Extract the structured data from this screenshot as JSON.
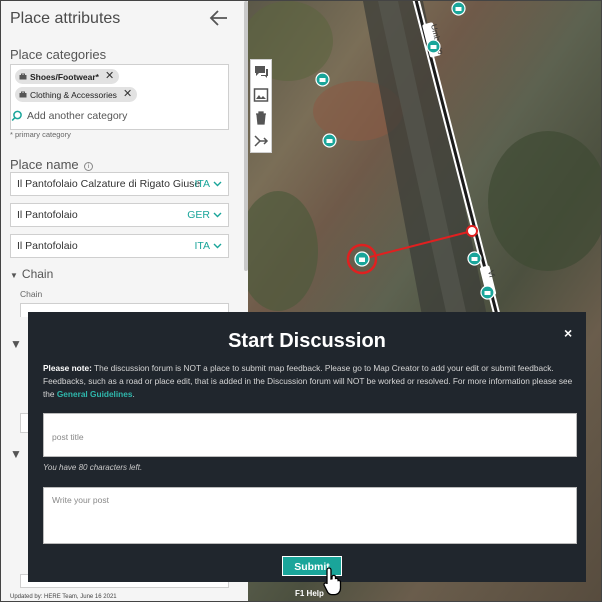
{
  "panel": {
    "title": "Place attributes",
    "categories_label": "Place categories",
    "chips": [
      {
        "label": "Shoes/Footwear*",
        "primary": true
      },
      {
        "label": "Clothing & Accessories",
        "primary": false
      }
    ],
    "add_category_placeholder": "Add another category",
    "primary_note": "* primary category",
    "place_name_label": "Place name",
    "names": [
      {
        "value": "Il Pantofolaio Calzature di Rigato Giuse",
        "lang": "ITA"
      },
      {
        "value": "Il Pantofolaio",
        "lang": "GER"
      },
      {
        "value": "Il Pantofolaio",
        "lang": "ITA"
      }
    ],
    "chain_header": "Chain",
    "chain_label": "Chain",
    "footer": "Updated by: HERE Team, June 16 2021"
  },
  "map": {
    "street_labels": [
      "Umberto",
      "Vi"
    ],
    "help_label": "F1 Help"
  },
  "dialog": {
    "title": "Start Discussion",
    "close": "×",
    "note_prefix": "Please note:",
    "note_text": " The discussion forum is NOT a place to submit map feedback. Please go to Map Creator to add your edit or submit feedback. Feedbacks, such as a road or place edit, that is added in the Discussion forum will NOT be worked or resolved. For more information please see the ",
    "note_link": "General Guidelines",
    "note_end": ".",
    "post_title_placeholder": "post title",
    "chars_left": "You have 80 characters left.",
    "post_body_placeholder": "Write your post",
    "submit_label": "Submit"
  },
  "colors": {
    "accent": "#1aa59a",
    "dialog_bg": "#20262d",
    "panel_bg": "#f5f5f5",
    "marker": "#e02020"
  }
}
